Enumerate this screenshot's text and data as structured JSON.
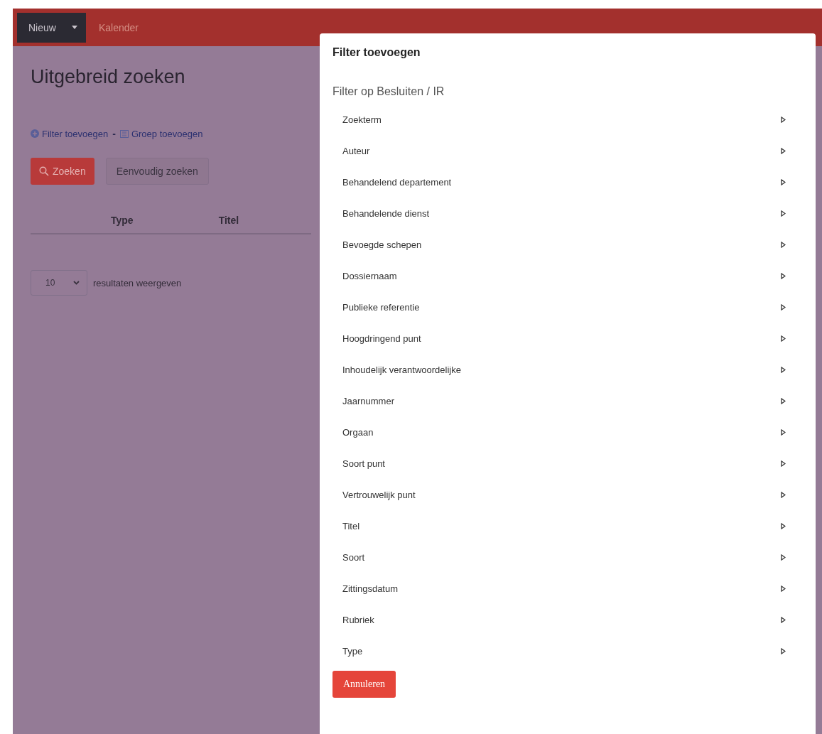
{
  "navbar": {
    "new_button": "Nieuw",
    "links": [
      "Kalender"
    ]
  },
  "page": {
    "title": "Uitgebreid zoeken",
    "actions": [
      "Filter toevoegen",
      "Groep toevoegen"
    ],
    "action_separator": "-",
    "search_button": "Zoeken",
    "simple_search_button": "Eenvoudig zoeken",
    "table": {
      "columns": [
        "Type",
        "Titel"
      ]
    },
    "page_size": {
      "value": "10",
      "label": "resultaten weergeven"
    }
  },
  "modal": {
    "title": "Filter toevoegen",
    "section": "Filter op Besluiten / IR",
    "items": [
      "Zoekterm",
      "Auteur",
      "Behandelend departement",
      "Behandelende dienst",
      "Bevoegde schepen",
      "Dossiernaam",
      "Publieke referentie",
      "Hoogdringend punt",
      "Inhoudelijk verantwoordelijke",
      "Jaarnummer",
      "Orgaan",
      "Soort punt",
      "Vertrouwelijk punt",
      "Titel",
      "Soort",
      "Zittingsdatum",
      "Rubriek",
      "Type"
    ],
    "cancel_button": "Annuleren"
  }
}
